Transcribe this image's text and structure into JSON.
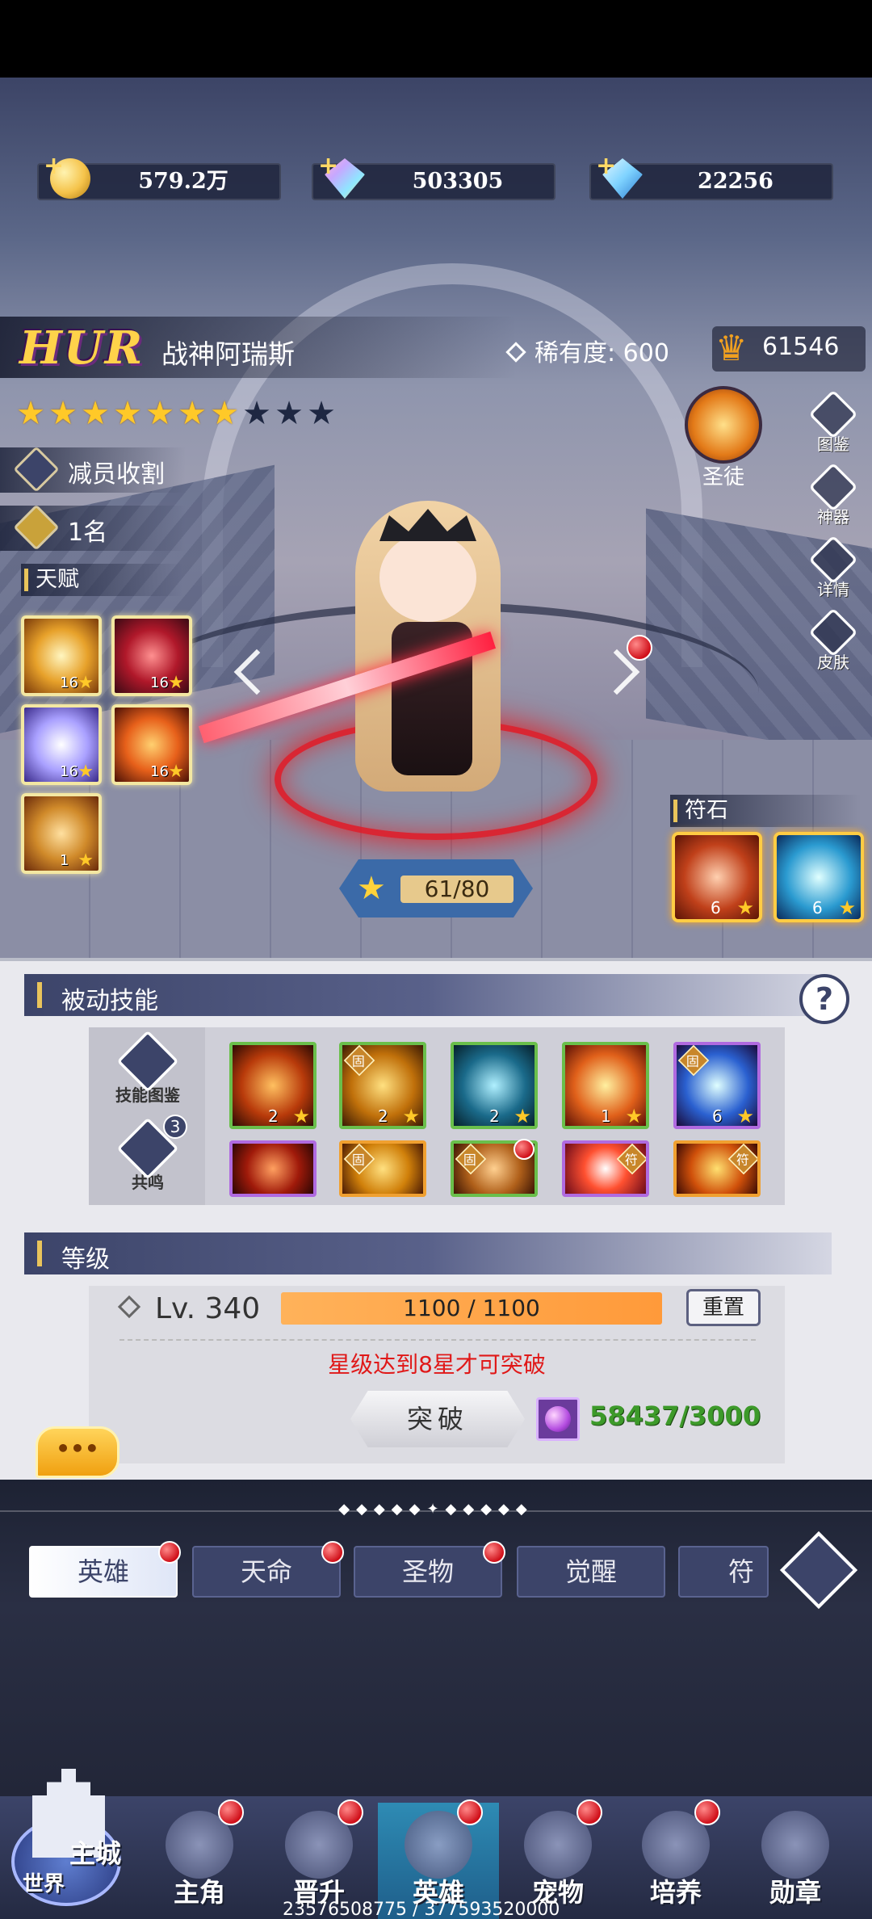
{
  "currencies": [
    {
      "name": "gold-coin",
      "value": "579.2万",
      "color": "#f5c34a"
    },
    {
      "name": "rainbow-gem",
      "value": "503305",
      "color": "#c6a8ff"
    },
    {
      "name": "blue-diamond",
      "value": "22256",
      "color": "#7fd3ff"
    }
  ],
  "hero": {
    "rarity_tag": "HUR",
    "name": "战神阿瑞斯",
    "rarity_label": "稀有度: 600",
    "power": "61546",
    "stars_filled": 7,
    "stars_total": 10,
    "trait": "减员收割",
    "rank": "1名",
    "talent_title": "天赋",
    "talents": [
      {
        "level": "16"
      },
      {
        "level": "16"
      },
      {
        "level": "16"
      },
      {
        "level": "16"
      },
      {
        "level": "1"
      }
    ],
    "saint_label": "圣徒",
    "side_buttons": [
      "图鉴",
      "神器",
      "详情",
      "皮肤"
    ],
    "exp_text": "61/80",
    "rune_title": "符石",
    "runes": [
      {
        "count": "6"
      },
      {
        "count": "6"
      }
    ]
  },
  "passive": {
    "title": "被动技能",
    "help": "?",
    "side_items": [
      "技能图鉴",
      "共鸣"
    ],
    "resonance_count": "3",
    "fixed_label": "固",
    "skills_row1": [
      {
        "count": "2",
        "border": "green",
        "fixed": false
      },
      {
        "count": "2",
        "border": "green",
        "fixed": true
      },
      {
        "count": "2",
        "border": "green",
        "fixed": false
      },
      {
        "count": "1",
        "border": "green",
        "fixed": false
      },
      {
        "count": "6",
        "border": "purple",
        "fixed": true
      }
    ],
    "skills_row2": [
      {
        "border": "purple",
        "fixed": false,
        "mark": ""
      },
      {
        "border": "orange",
        "fixed": true,
        "mark": "固"
      },
      {
        "border": "green",
        "fixed": true,
        "mark": "固"
      },
      {
        "border": "purple",
        "fixed": false,
        "mark": "符"
      },
      {
        "border": "orange",
        "fixed": false,
        "mark": "符"
      }
    ]
  },
  "level": {
    "title": "等级",
    "lv_text": "Lv. 340",
    "exp_text": "1100 / 1100",
    "reset_label": "重置",
    "warning": "星级达到8星才可突破",
    "break_label": "突破",
    "cost_text": "58437/3000"
  },
  "chat_label": "•••",
  "tabs": [
    {
      "label": "英雄",
      "dot": true,
      "active": true
    },
    {
      "label": "天命",
      "dot": true,
      "active": false
    },
    {
      "label": "圣物",
      "dot": true,
      "active": false
    },
    {
      "label": "觉醒",
      "dot": false,
      "active": false
    },
    {
      "label": "符文",
      "dot": false,
      "active": false
    }
  ],
  "nav": {
    "city_label": "主城",
    "world_label": "世界",
    "items": [
      {
        "label": "主角",
        "dot": true,
        "active": false
      },
      {
        "label": "晋升",
        "dot": true,
        "active": false
      },
      {
        "label": "英雄",
        "dot": true,
        "active": true
      },
      {
        "label": "宠物",
        "dot": true,
        "active": false
      },
      {
        "label": "培养",
        "dot": true,
        "active": false
      },
      {
        "label": "勋章",
        "dot": false,
        "active": false
      }
    ]
  },
  "debug_text": "23576508775 / 377593520000"
}
